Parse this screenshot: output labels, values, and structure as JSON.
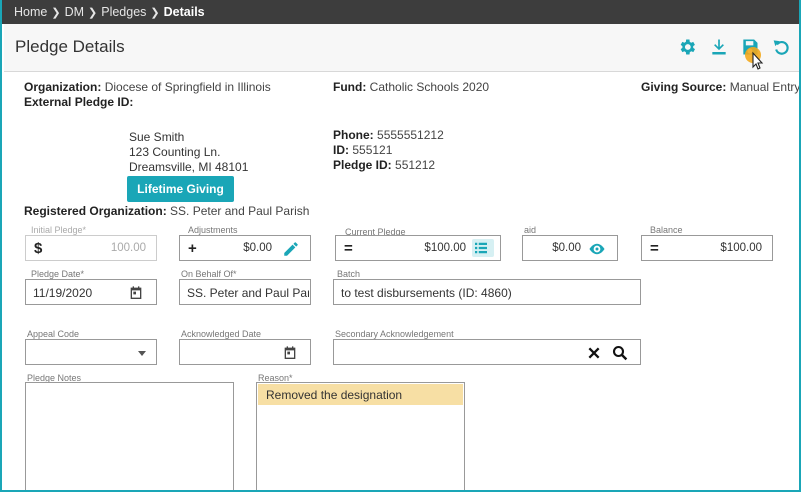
{
  "breadcrumb": {
    "items": [
      "Home",
      "DM",
      "Pledges"
    ],
    "current": "Details"
  },
  "header": {
    "title": "Pledge Details"
  },
  "toolbar": {
    "icons": [
      "gear-icon",
      "download-icon",
      "save-icon",
      "undo-icon"
    ]
  },
  "colors": {
    "accent": "#1aa6b7",
    "breadcrumb_bg": "#3d3d3d",
    "reason_highlight": "#f7dfa4"
  },
  "info": {
    "organization_label": "Organization:",
    "organization": "Diocese of Springfield in Illinois",
    "external_pledge_id_label": "External Pledge ID:",
    "fund_label": "Fund:",
    "fund": "Catholic Schools 2020",
    "giving_source_label": "Giving Source:",
    "giving_source": "Manual Entry",
    "phone_label": "Phone:",
    "phone": "5555551212",
    "id_label": "ID:",
    "id": "555121",
    "pledge_id_label": "Pledge ID:",
    "pledge_id": "551212",
    "registered_org_label": "Registered Organization:",
    "registered_org": "SS. Peter and Paul Parish"
  },
  "donor": {
    "name": "Sue Smith",
    "street": "123 Counting Ln.",
    "city": "Dreamsville, MI 48101"
  },
  "lifetime_button": "Lifetime Giving",
  "fields": {
    "initial_pledge": {
      "label": "Initial Pledge*",
      "prefix": "$",
      "value": "100.00"
    },
    "adjustments": {
      "label": "Adjustments",
      "prefix": "+",
      "value": "$0.00"
    },
    "current_pledge": {
      "label": "Current Pledge",
      "prefix": "=",
      "value": "$100.00"
    },
    "paid": {
      "label": "aid",
      "value": "$0.00"
    },
    "balance": {
      "label": "Balance",
      "prefix": "=",
      "value": "$100.00"
    },
    "pledge_date": {
      "label": "Pledge Date*",
      "value": "11/19/2020"
    },
    "on_behalf_of": {
      "label": "On Behalf Of*",
      "value": "SS. Peter and Paul Par"
    },
    "batch": {
      "label": "Batch",
      "value": "to test disbursements (ID: 4860)"
    },
    "appeal_code": {
      "label": "Appeal Code",
      "value": ""
    },
    "acknowledged_date": {
      "label": "Acknowledged Date",
      "value": ""
    },
    "secondary_ack": {
      "label": "Secondary Acknowledgement",
      "value": ""
    },
    "pledge_notes": {
      "label": "Pledge Notes",
      "value": ""
    },
    "reason": {
      "label": "Reason*",
      "value": "Removed the designation"
    }
  }
}
